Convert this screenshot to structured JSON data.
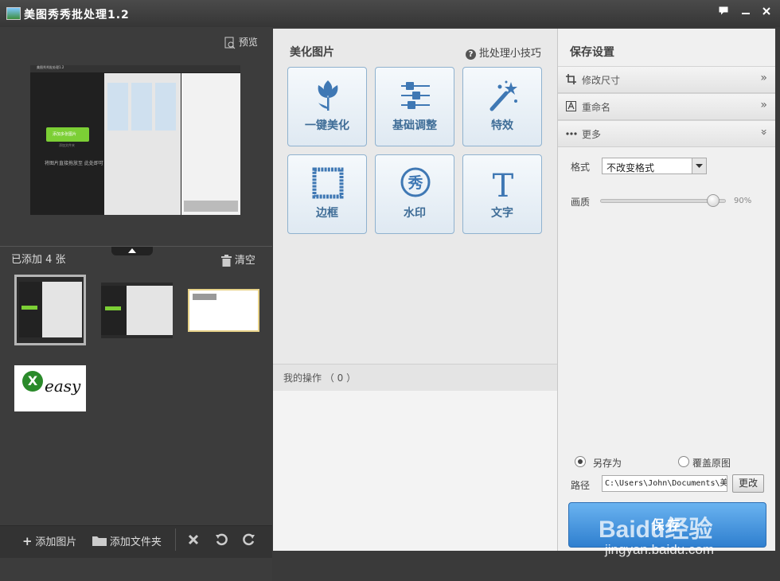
{
  "window": {
    "title": "美图秀秀批处理1.2"
  },
  "left_panel": {
    "preview_label": "预览",
    "added_count": "已添加 4 张",
    "clear_label": "清空",
    "add_image_label": "添加图片",
    "add_folder_label": "添加文件夹",
    "preview_thumb": {
      "title": "美图秀秀批处理1.2",
      "add_button": "添加多张图片",
      "add_folder_hint": "添加文件夹",
      "drag_hint": "将图片直接拖放至 此处即可"
    },
    "thumb4_text": "easy"
  },
  "middle_panel": {
    "section_title": "美化图片",
    "tips_label": "批处理小技巧",
    "tiles": [
      {
        "label": "一键美化",
        "icon": "tulip-icon"
      },
      {
        "label": "基础调整",
        "icon": "sliders-icon"
      },
      {
        "label": "特效",
        "icon": "magic-wand-icon"
      },
      {
        "label": "边框",
        "icon": "frame-icon"
      },
      {
        "label": "水印",
        "icon": "watermark-icon",
        "glyph": "秀"
      },
      {
        "label": "文字",
        "icon": "text-icon",
        "glyph": "T"
      }
    ],
    "my_ops": "我的操作 （ 0 ）"
  },
  "right_panel": {
    "title": "保存设置",
    "sections": [
      {
        "label": "修改尺寸",
        "icon": "crop-icon",
        "chevron": "»"
      },
      {
        "label": "重命名",
        "icon": "rename-icon",
        "chevron": "»"
      },
      {
        "label": "更多",
        "icon": "more-icon",
        "chevron": "»"
      }
    ],
    "format_label": "格式",
    "format_value": "不改变格式",
    "quality_label": "画质",
    "quality_value": "90%",
    "quality_level": 0.9,
    "save_as_label": "另存为",
    "overwrite_label": "覆盖原图",
    "path_label": "路径",
    "path_value": "C:\\Users\\John\\Documents\\美",
    "change_label": "更改",
    "save_label": "保存"
  },
  "watermark": {
    "brand": "Baidu经验",
    "url": "jingyan.baidu.com"
  },
  "colors": {
    "accent_blue": "#3a86d6",
    "tile_text": "#3f6d97",
    "dark_bg": "#3c3c3c"
  }
}
